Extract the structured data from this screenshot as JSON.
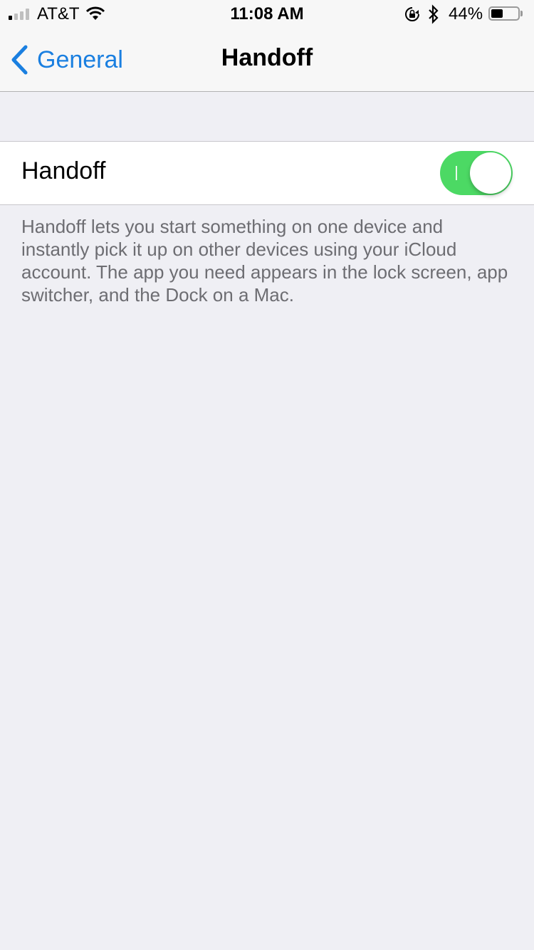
{
  "status_bar": {
    "carrier": "AT&T",
    "time": "11:08 AM",
    "battery_percent": "44%",
    "battery_level": 0.44,
    "signal_bars_filled": 1,
    "signal_bars_total": 4,
    "icons": [
      "signal-icon",
      "wifi-icon",
      "rotation-lock-icon",
      "bluetooth-icon",
      "battery-icon"
    ]
  },
  "nav": {
    "back_label": "General",
    "title": "Handoff"
  },
  "settings": {
    "handoff_label": "Handoff",
    "handoff_enabled": true,
    "footer": "Handoff lets you start something on one device and instantly pick it up on other devices using your iCloud account. The app you need appears in the lock screen, app switcher, and the Dock on a Mac."
  },
  "colors": {
    "accent": "#1a7fe0",
    "toggle_on": "#4cd964",
    "background": "#efeff4",
    "footer_text": "#6d6d72"
  }
}
